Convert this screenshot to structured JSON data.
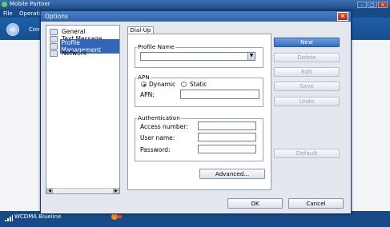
{
  "app": {
    "title": "Mobile Partner",
    "menu": [
      "File",
      "Operations"
    ],
    "toolbar_label": "Con",
    "status_network": "WCDMA  Blueline",
    "window_controls": [
      "minimize-icon",
      "restore-icon",
      "close-icon"
    ]
  },
  "dialog": {
    "title": "Options",
    "close_glyph": "✕",
    "tree": [
      {
        "label": "General",
        "selected": false
      },
      {
        "label": "Text Message",
        "selected": false
      },
      {
        "label": "Profile Management",
        "selected": true
      },
      {
        "label": "Network",
        "selected": false
      }
    ],
    "tab_label": "Dial-Up",
    "profile_group": {
      "title": "Profile Name",
      "value": ""
    },
    "apn_group": {
      "title": "APN",
      "dynamic_label": "Dynamic",
      "static_label": "Static",
      "selected": "Dynamic",
      "apn_label": "APN:",
      "apn_value": ""
    },
    "auth_group": {
      "title": "Authentication",
      "access_label": "Access number:",
      "access_value": "",
      "user_label": "User name:",
      "user_value": "",
      "password_label": "Password:",
      "password_value": ""
    },
    "advanced_label": "Advanced...",
    "side_buttons": {
      "new": "New",
      "delete": "Delete",
      "edit": "Edit",
      "save": "Save",
      "undo": "Undo",
      "default": "Default"
    },
    "ok_label": "OK",
    "cancel_label": "Cancel"
  },
  "colors": {
    "accent": "#3366b8",
    "titlebar": "#2d62a8",
    "close": "#c8361c",
    "disabled_text": "#9aa2ad"
  }
}
